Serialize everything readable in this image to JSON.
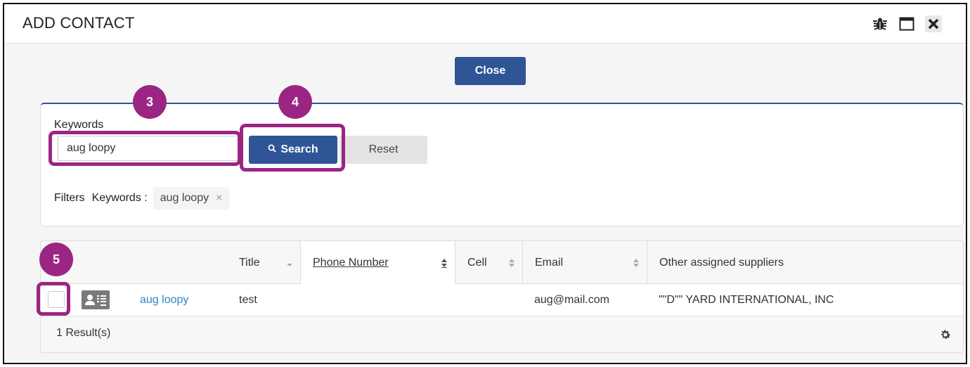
{
  "dialog": {
    "title": "ADD CONTACT",
    "header_icons": [
      "bug-icon",
      "maximize-icon",
      "close-icon"
    ],
    "close_label": "Close"
  },
  "search": {
    "keywords_label": "Keywords",
    "keywords_value": "aug loopy",
    "search_label": "Search",
    "reset_label": "Reset",
    "filters_label": "Filters",
    "filter_key": "Keywords :",
    "filter_value": "aug loopy",
    "filter_remove_icon": "×"
  },
  "table": {
    "columns": [
      {
        "label": "Title",
        "sort": "descending-muted"
      },
      {
        "label": "Phone Number",
        "sort": "both-active"
      },
      {
        "label": "Cell",
        "sort": "both"
      },
      {
        "label": "Email",
        "sort": "both"
      },
      {
        "label": "Other assigned suppliers",
        "sort": "none"
      }
    ],
    "rows": [
      {
        "checked": false,
        "name": "aug loopy",
        "title": "test",
        "phone": "",
        "cell": "",
        "email": "aug@mail.com",
        "suppliers": "\"\"D\"\" YARD INTERNATIONAL, INC"
      }
    ],
    "results_count": "1 Result(s)"
  },
  "annotations": [
    {
      "number": "3",
      "target": "keywords-input"
    },
    {
      "number": "4",
      "target": "search-button"
    },
    {
      "number": "5",
      "target": "row-checkbox"
    }
  ],
  "colors": {
    "primary": "#2f5597",
    "annotation": "#9b2583",
    "link": "#2a87c8"
  }
}
